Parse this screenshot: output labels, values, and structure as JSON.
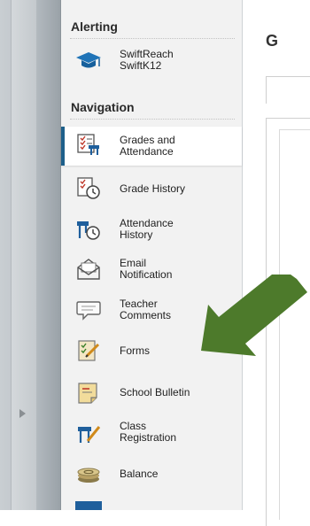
{
  "sidebar": {
    "alerting_title": "Alerting",
    "alerting_item": {
      "label": "SwiftReach\nSwiftK12",
      "icon": "graduation-cap-icon"
    },
    "navigation_title": "Navigation",
    "items": [
      {
        "label": "Grades and\nAttendance",
        "icon": "grades-attendance-icon",
        "active": true
      },
      {
        "label": "Grade History",
        "icon": "grade-history-icon"
      },
      {
        "label": "Attendance\nHistory",
        "icon": "attendance-history-icon"
      },
      {
        "label": "Email\nNotification",
        "icon": "email-icon"
      },
      {
        "label": "Teacher\nComments",
        "icon": "comment-bubble-icon"
      },
      {
        "label": "Forms",
        "icon": "forms-icon"
      },
      {
        "label": "School Bulletin",
        "icon": "bulletin-icon"
      },
      {
        "label": "Class\nRegistration",
        "icon": "class-registration-icon"
      },
      {
        "label": "Balance",
        "icon": "coins-icon"
      }
    ]
  },
  "content": {
    "title_partial": "G"
  },
  "colors": {
    "accent": "#1d5f8a",
    "arrow": "#4d7a2b",
    "sidebar_bg": "#f2f2f2"
  }
}
